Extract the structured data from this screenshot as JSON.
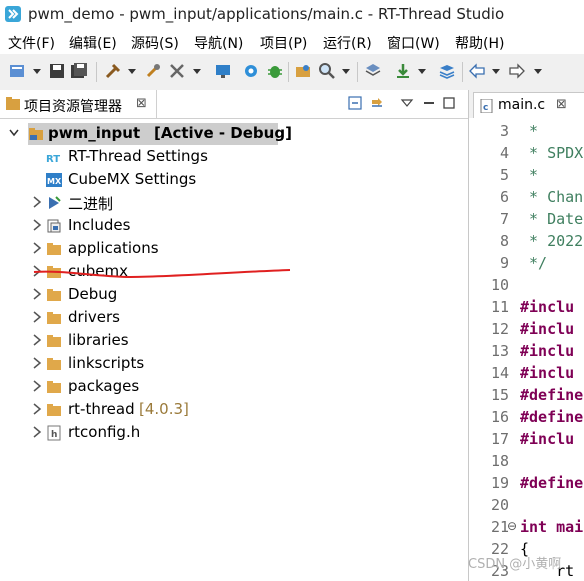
{
  "window": {
    "title": "pwm_demo - pwm_input/applications/main.c - RT-Thread Studio",
    "app_icon": "rt-thread-studio-icon"
  },
  "menu": {
    "items": [
      "文件(F)",
      "编辑(E)",
      "源码(S)",
      "导航(N)",
      "项目(P)",
      "运行(R)",
      "窗口(W)",
      "帮助(H)"
    ]
  },
  "toolbar": {
    "icons": [
      "new-icon",
      "save-icon",
      "save-all-icon",
      "build-icon",
      "clean-icon",
      "tools-icon",
      "monitor-icon",
      "settings-icon",
      "debug-icon",
      "open-project-icon",
      "search-icon",
      "book-icon",
      "download-icon",
      "layers-icon",
      "back-icon",
      "forward-icon"
    ]
  },
  "explorer": {
    "tab_label": "项目资源管理器",
    "tab_close": "⊠",
    "project": {
      "name": "pwm_input",
      "status": "[Active - Debug]"
    },
    "items": [
      {
        "label": "RT-Thread Settings",
        "icon": "rt-settings-icon",
        "expandable": false
      },
      {
        "label": "CubeMX Settings",
        "icon": "cubemx-icon",
        "expandable": false
      },
      {
        "label": "二进制",
        "icon": "binary-icon",
        "expandable": true
      },
      {
        "label": "Includes",
        "icon": "includes-icon",
        "expandable": true
      },
      {
        "label": "applications",
        "icon": "folder-icon",
        "expandable": true
      },
      {
        "label": "cubemx",
        "icon": "folder-icon",
        "expandable": true
      },
      {
        "label": "Debug",
        "icon": "folder-icon",
        "expandable": true
      },
      {
        "label": "drivers",
        "icon": "folder-icon",
        "expandable": true
      },
      {
        "label": "libraries",
        "icon": "folder-icon",
        "expandable": true
      },
      {
        "label": "linkscripts",
        "icon": "folder-icon",
        "expandable": true
      },
      {
        "label": "packages",
        "icon": "folder-icon",
        "expandable": true
      },
      {
        "label": "rt-thread",
        "icon": "folder-icon",
        "expandable": true,
        "version": "[4.0.3]"
      },
      {
        "label": "rtconfig.h",
        "icon": "header-file-icon",
        "expandable": true
      }
    ]
  },
  "editor": {
    "tab_label": "main.c",
    "tab_close": "⊠",
    "lines": [
      {
        "n": "3",
        "text": " *",
        "kind": "comment"
      },
      {
        "n": "4",
        "text": " * SPDX",
        "kind": "comment"
      },
      {
        "n": "5",
        "text": " *",
        "kind": "comment"
      },
      {
        "n": "6",
        "text": " * Chan",
        "kind": "comment"
      },
      {
        "n": "7",
        "text": " * Date",
        "kind": "comment"
      },
      {
        "n": "8",
        "text": " * 2022",
        "kind": "comment"
      },
      {
        "n": "9",
        "text": " */",
        "kind": "comment"
      },
      {
        "n": "10",
        "text": "",
        "kind": "plain"
      },
      {
        "n": "11",
        "text": "#inclu",
        "kind": "dir"
      },
      {
        "n": "12",
        "text": "#inclu",
        "kind": "dir"
      },
      {
        "n": "13",
        "text": "#inclu",
        "kind": "dir"
      },
      {
        "n": "14",
        "text": "#inclu",
        "kind": "dir"
      },
      {
        "n": "15",
        "text": "#define",
        "kind": "dir"
      },
      {
        "n": "16",
        "text": "#define",
        "kind": "dir"
      },
      {
        "n": "17",
        "text": "#inclu",
        "kind": "dir"
      },
      {
        "n": "18",
        "text": "",
        "kind": "plain"
      },
      {
        "n": "19",
        "text": "#define",
        "kind": "dir"
      },
      {
        "n": "20",
        "text": "",
        "kind": "plain"
      },
      {
        "n": "21",
        "text": "int mai",
        "kind": "kw",
        "marker": "⊖"
      },
      {
        "n": "22",
        "text": "{",
        "kind": "plain"
      },
      {
        "n": "23",
        "text": "    rt",
        "kind": "plain"
      }
    ]
  },
  "watermark": "CSDN @小黄啊"
}
